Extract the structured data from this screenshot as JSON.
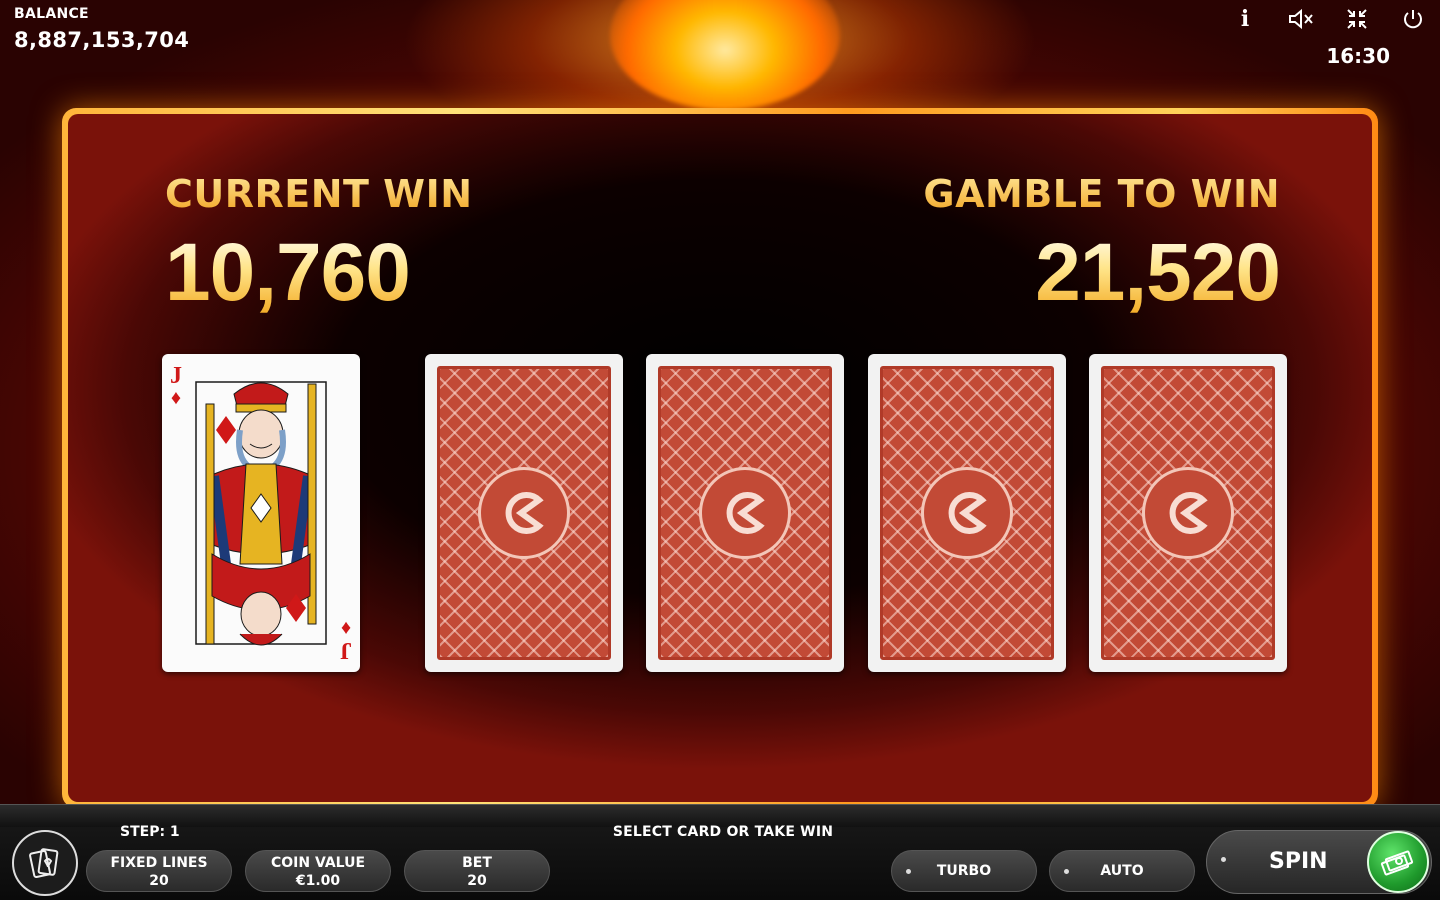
{
  "balance": {
    "label": "BALANCE",
    "value": "8,887,153,704"
  },
  "clock": "16:30",
  "top_icons": [
    "info-icon",
    "sound-muted-icon",
    "collapse-icon",
    "power-icon"
  ],
  "top_icon_glyphs": {
    "info": "i"
  },
  "gamble": {
    "current_win_label": "CURRENT WIN",
    "current_win_value": "10,760",
    "gamble_label": "GAMBLE TO WIN",
    "gamble_value": "21,520",
    "dealer_card": {
      "rank": "J",
      "suit": "♦"
    },
    "face_down_cards": 4
  },
  "footer": {
    "step": "STEP: 1",
    "message": "SELECT CARD OR TAKE WIN",
    "fixed_lines_label": "FIXED LINES",
    "fixed_lines_value": "20",
    "coin_value_label": "COIN VALUE",
    "coin_value_value": "€1.00",
    "bet_label": "BET",
    "bet_value": "20",
    "turbo_label": "TURBO",
    "auto_label": "AUTO",
    "spin_label": "SPIN"
  },
  "colors": {
    "accent_gold": "#f1a21e",
    "card_back": "#c24a36",
    "spin_green": "#1f9a2c"
  }
}
